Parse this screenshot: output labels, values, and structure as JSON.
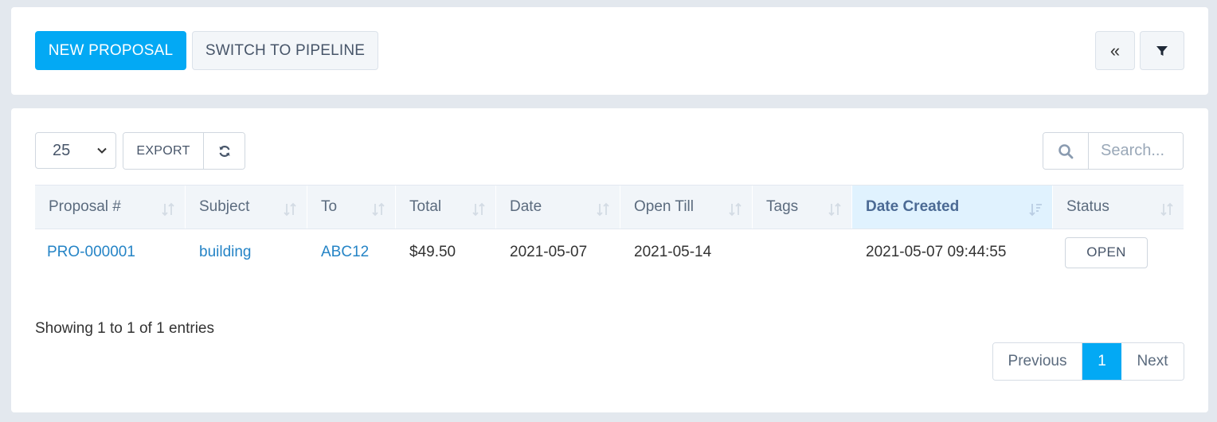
{
  "toolbar": {
    "new_proposal": "NEW PROPOSAL",
    "switch_pipeline": "SWITCH TO PIPELINE",
    "collapse_icon": "double-chevron-left-icon",
    "filter_icon": "filter-icon"
  },
  "table_controls": {
    "page_length": "25",
    "export_label": "EXPORT",
    "reload_icon": "refresh-icon",
    "search_placeholder": "Search..."
  },
  "table": {
    "columns": [
      "Proposal #",
      "Subject",
      "To",
      "Total",
      "Date",
      "Open Till",
      "Tags",
      "Date Created",
      "Status"
    ],
    "sorted_column": "Date Created",
    "rows": [
      {
        "proposal": "PRO-000001",
        "subject": "building",
        "to": "ABC12",
        "total": "$49.50",
        "date": "2021-05-07",
        "open_till": "2021-05-14",
        "tags": "",
        "date_created": "2021-05-07 09:44:55",
        "status": "OPEN"
      }
    ]
  },
  "footer": {
    "info": "Showing 1 to 1 of 1 entries",
    "previous": "Previous",
    "current_page": "1",
    "next": "Next"
  },
  "colors": {
    "primary": "#03a9f4",
    "link": "#2584c6",
    "page_bg": "#e3e8ee"
  }
}
